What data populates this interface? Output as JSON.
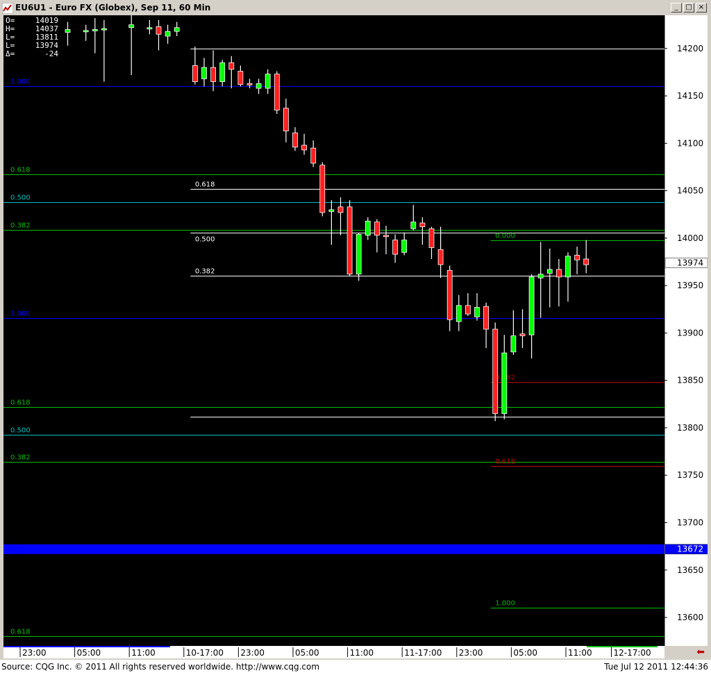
{
  "window": {
    "title": "EU6U1 - Euro FX (Globex), Sep 11, 60 Min",
    "buttons": [
      "_",
      "□",
      "×"
    ]
  },
  "ohlc_box": [
    {
      "k": "O=",
      "v": "14019"
    },
    {
      "k": "H=",
      "v": "14037"
    },
    {
      "k": "L=",
      "v": "13811"
    },
    {
      "k": "L=",
      "v": "13974"
    },
    {
      "k": "Δ=",
      "v": "-24"
    }
  ],
  "status": {
    "source": "Source: CQG Inc. © 2011 All rights reserved worldwide. http://www.cqg.com",
    "datetime": "Tue Jul 12 2011 12:44:36"
  },
  "colors": {
    "background": "#000000",
    "up_candle": "#00ff00",
    "down_candle": "#ff2020",
    "fib_green": "#00c000",
    "fib_cyan": "#00c0c0",
    "fib_blue": "#0000ff",
    "fib_red": "#c00000",
    "fib_white": "#ffffff",
    "current_price_bar": "#0000ff"
  },
  "chart_data": {
    "type": "candlestick",
    "title": "EU6U1 - Euro FX (Globex), Sep 11, 60 Min",
    "ylim": [
      13570,
      14235
    ],
    "price_ticks": [
      "14200",
      "14150",
      "14100",
      "14050",
      "14000",
      "13950",
      "13900",
      "13850",
      "13800",
      "13750",
      "13700",
      "13650",
      "13600"
    ],
    "time_labels": [
      {
        "bar": 0,
        "label": "23:00"
      },
      {
        "bar": 6,
        "label": "05:00"
      },
      {
        "bar": 12,
        "label": "11:00"
      },
      {
        "bar": 18,
        "label": "10-17:00"
      },
      {
        "bar": 24,
        "label": "23:00"
      },
      {
        "bar": 30,
        "label": "05:00"
      },
      {
        "bar": 36,
        "label": "11:00"
      },
      {
        "bar": 42,
        "label": "11-17:00"
      },
      {
        "bar": 48,
        "label": "23:00"
      },
      {
        "bar": 54,
        "label": "05:00"
      },
      {
        "bar": 60,
        "label": "11:00"
      },
      {
        "bar": 65,
        "label": "12-17:00"
      }
    ],
    "current_price": {
      "label": "13974",
      "value": 13974
    },
    "marker_price": {
      "label": "13672",
      "value": 13672
    },
    "candles": [
      {
        "bar": 5,
        "o": 14217,
        "h": 14228,
        "l": 14203,
        "c": 14220
      },
      {
        "bar": 7,
        "o": 14218,
        "h": 14225,
        "l": 14208,
        "c": 14219
      },
      {
        "bar": 8,
        "o": 14220,
        "h": 14232,
        "l": 14195,
        "c": 14220
      },
      {
        "bar": 9,
        "o": 14220,
        "h": 14230,
        "l": 14165,
        "c": 14221
      },
      {
        "bar": 12,
        "o": 14222,
        "h": 14238,
        "l": 14172,
        "c": 14225
      },
      {
        "bar": 14,
        "o": 14221,
        "h": 14230,
        "l": 14215,
        "c": 14222
      },
      {
        "bar": 15,
        "o": 14223,
        "h": 14230,
        "l": 14198,
        "c": 14215
      },
      {
        "bar": 16,
        "o": 14213,
        "h": 14225,
        "l": 14205,
        "c": 14218
      },
      {
        "bar": 17,
        "o": 14218,
        "h": 14228,
        "l": 14213,
        "c": 14222
      },
      {
        "bar": 19,
        "o": 14182,
        "h": 14202,
        "l": 14162,
        "c": 14165
      },
      {
        "bar": 20,
        "o": 14168,
        "h": 14190,
        "l": 14160,
        "c": 14180
      },
      {
        "bar": 21,
        "o": 14180,
        "h": 14198,
        "l": 14155,
        "c": 14165
      },
      {
        "bar": 22,
        "o": 14165,
        "h": 14188,
        "l": 14160,
        "c": 14185
      },
      {
        "bar": 23,
        "o": 14185,
        "h": 14192,
        "l": 14158,
        "c": 14178
      },
      {
        "bar": 24,
        "o": 14176,
        "h": 14182,
        "l": 14160,
        "c": 14162
      },
      {
        "bar": 25,
        "o": 14163,
        "h": 14168,
        "l": 14158,
        "c": 14162
      },
      {
        "bar": 26,
        "o": 14158,
        "h": 14168,
        "l": 14152,
        "c": 14163
      },
      {
        "bar": 27,
        "o": 14158,
        "h": 14178,
        "l": 14152,
        "c": 14173
      },
      {
        "bar": 28,
        "o": 14173,
        "h": 14176,
        "l": 14131,
        "c": 14135
      },
      {
        "bar": 29,
        "o": 14137,
        "h": 14147,
        "l": 14101,
        "c": 14113
      },
      {
        "bar": 30,
        "o": 14111,
        "h": 14117,
        "l": 14092,
        "c": 14096
      },
      {
        "bar": 31,
        "o": 14098,
        "h": 14110,
        "l": 14088,
        "c": 14093
      },
      {
        "bar": 32,
        "o": 14095,
        "h": 14103,
        "l": 14075,
        "c": 14079
      },
      {
        "bar": 33,
        "o": 14077,
        "h": 14080,
        "l": 14023,
        "c": 14027
      },
      {
        "bar": 34,
        "o": 14028,
        "h": 14040,
        "l": 13993,
        "c": 14030
      },
      {
        "bar": 35,
        "o": 14033,
        "h": 14043,
        "l": 14003,
        "c": 14027
      },
      {
        "bar": 36,
        "o": 14033,
        "h": 14040,
        "l": 13960,
        "c": 13962
      },
      {
        "bar": 37,
        "o": 13962,
        "h": 14005,
        "l": 13955,
        "c": 14004
      },
      {
        "bar": 38,
        "o": 14003,
        "h": 14022,
        "l": 13998,
        "c": 14018
      },
      {
        "bar": 39,
        "o": 14017,
        "h": 14020,
        "l": 13985,
        "c": 14003
      },
      {
        "bar": 40,
        "o": 14003,
        "h": 14013,
        "l": 13983,
        "c": 14002
      },
      {
        "bar": 41,
        "o": 13998,
        "h": 14004,
        "l": 13974,
        "c": 13983
      },
      {
        "bar": 42,
        "o": 13985,
        "h": 14006,
        "l": 13982,
        "c": 13998
      },
      {
        "bar": 43,
        "o": 14010,
        "h": 14035,
        "l": 14008,
        "c": 14017
      },
      {
        "bar": 44,
        "o": 14016,
        "h": 14022,
        "l": 13993,
        "c": 14012
      },
      {
        "bar": 45,
        "o": 14010,
        "h": 14012,
        "l": 13978,
        "c": 13990
      },
      {
        "bar": 46,
        "o": 13988,
        "h": 14012,
        "l": 13958,
        "c": 13972
      },
      {
        "bar": 47,
        "o": 13966,
        "h": 13971,
        "l": 13902,
        "c": 13914
      },
      {
        "bar": 48,
        "o": 13912,
        "h": 13940,
        "l": 13902,
        "c": 13929
      },
      {
        "bar": 49,
        "o": 13929,
        "h": 13942,
        "l": 13918,
        "c": 13920
      },
      {
        "bar": 50,
        "o": 13917,
        "h": 13942,
        "l": 13913,
        "c": 13927
      },
      {
        "bar": 51,
        "o": 13928,
        "h": 13932,
        "l": 13884,
        "c": 13904
      },
      {
        "bar": 52,
        "o": 13904,
        "h": 13911,
        "l": 13807,
        "c": 13815
      },
      {
        "bar": 53,
        "o": 13815,
        "h": 13898,
        "l": 13809,
        "c": 13879
      },
      {
        "bar": 54,
        "o": 13880,
        "h": 13924,
        "l": 13877,
        "c": 13897
      },
      {
        "bar": 55,
        "o": 13899,
        "h": 13925,
        "l": 13884,
        "c": 13897
      },
      {
        "bar": 56,
        "o": 13898,
        "h": 13962,
        "l": 13873,
        "c": 13959
      },
      {
        "bar": 57,
        "o": 13958,
        "h": 13996,
        "l": 13916,
        "c": 13962
      },
      {
        "bar": 58,
        "o": 13963,
        "h": 13989,
        "l": 13927,
        "c": 13967
      },
      {
        "bar": 59,
        "o": 13967,
        "h": 13978,
        "l": 13928,
        "c": 13959
      },
      {
        "bar": 60,
        "o": 13959,
        "h": 13985,
        "l": 13933,
        "c": 13981
      },
      {
        "bar": 61,
        "o": 13982,
        "h": 13991,
        "l": 13962,
        "c": 13977
      },
      {
        "bar": 62,
        "o": 13978,
        "h": 13998,
        "l": 13963,
        "c": 13972
      }
    ],
    "fib_levels": [
      {
        "label": "1.000",
        "value": 14160,
        "x0": 0,
        "x1": 72,
        "color": "#0000ff",
        "label_at": 0
      },
      {
        "label": "0.618",
        "value": 14067,
        "x0": 0,
        "x1": 72,
        "color": "#00c000",
        "label_at": 0
      },
      {
        "label": "0.500",
        "value": 14038,
        "x0": 0,
        "x1": 72,
        "color": "#00c0c0",
        "label_at": 0
      },
      {
        "label": "0.382",
        "value": 14009,
        "x0": 0,
        "x1": 72,
        "color": "#00c000",
        "label_at": 0
      },
      {
        "label": "1.000",
        "value": 13916,
        "x0": 0,
        "x1": 72,
        "color": "#0000ff",
        "label_at": 0
      },
      {
        "label": "0.618",
        "value": 13822,
        "x0": 0,
        "x1": 72,
        "color": "#00c000",
        "label_at": 0
      },
      {
        "label": "0.500",
        "value": 13793,
        "x0": 0,
        "x1": 72,
        "color": "#00c0c0",
        "label_at": 0
      },
      {
        "label": "0.382",
        "value": 13764,
        "x0": 0,
        "x1": 72,
        "color": "#00c000",
        "label_at": 0
      },
      {
        "label": "0.618",
        "value": 13580,
        "x0": 0,
        "x1": 72,
        "color": "#00c000",
        "label_at": 0
      },
      {
        "label": "",
        "value": 14200,
        "x0": 18.5,
        "x1": 72,
        "color": "#ffffff",
        "label_at": 18.5
      },
      {
        "label": "0.618",
        "value": 14052,
        "x0": 18.5,
        "x1": 72,
        "color": "#ffffff",
        "label_at": 19
      },
      {
        "label": "0.500",
        "value": 14006,
        "x0": 18.5,
        "x1": 72,
        "color": "#ffffff",
        "label_at": 19
      },
      {
        "label": "0.382",
        "value": 13960,
        "x0": 18.5,
        "x1": 72,
        "color": "#ffffff",
        "label_at": 19
      },
      {
        "label": "",
        "value": 13812,
        "x0": 18.5,
        "x1": 72,
        "color": "#ffffff",
        "label_at": 18.5
      },
      {
        "label": "0.000",
        "value": 13998,
        "x0": 51.5,
        "x1": 72,
        "color": "#00c000",
        "label_at": 52
      },
      {
        "label": "0.382",
        "value": 13848,
        "x0": 51.5,
        "x1": 72,
        "color": "#c00000",
        "label_at": 52
      },
      {
        "label": "0.618",
        "value": 13760,
        "x0": 51.5,
        "x1": 72,
        "color": "#c00000",
        "label_at": 52
      },
      {
        "label": "1.000",
        "value": 13610,
        "x0": 51.5,
        "x1": 72,
        "color": "#00c000",
        "label_at": 52
      }
    ]
  }
}
